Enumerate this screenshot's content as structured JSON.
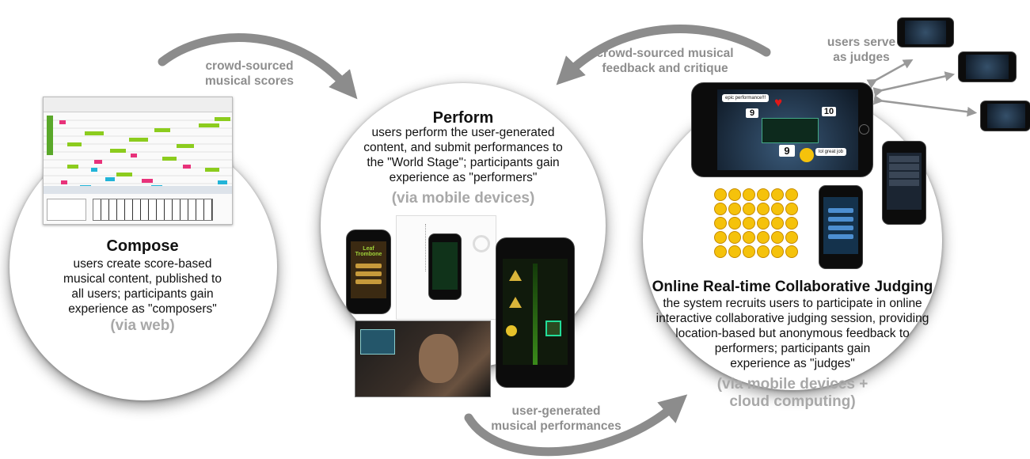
{
  "flows": {
    "scores": "crowd-sourced\nmusical scores",
    "feedback": "crowd-sourced musical\nfeedback and critique",
    "performances": "user-generated\nmusical performances",
    "judges": "users serve\nas judges"
  },
  "compose": {
    "title": "Compose",
    "description": "users create score-based\nmusical content, published to\nall users; participants gain\nexperience as \"composers\"",
    "via": "(via web)"
  },
  "perform": {
    "title": "Perform",
    "description": "users perform the user-generated\ncontent, and submit performances to\nthe \"World Stage\"; participants gain\nexperience as \"performers\"",
    "via": "(via mobile devices)"
  },
  "judge": {
    "title": "Online Real-time Collaborative Judging",
    "description": "the system recruits users to participate in online\ninteractive collaborative judging session, providing\nlocation-based but anonymous feedback to\nperformers;  participants gain\nexperience as \"judges\"",
    "via": "(via mobile devices +\ncloud computing)"
  },
  "screens": {
    "judge_bubble_1": "epic performance!!!",
    "judge_bubble_2": "lol great job",
    "judge_score_1": "9",
    "judge_score_2": "10",
    "judge_score_3": "9",
    "app_name": "Leaf Trombone"
  },
  "colors": {
    "arrow": "#8c8c8c",
    "flow_text": "#8e8e8e",
    "via_text": "#a8a8a8",
    "note_green": "#8ccc1e",
    "note_pink": "#e8327a",
    "note_cyan": "#22b4d8"
  }
}
